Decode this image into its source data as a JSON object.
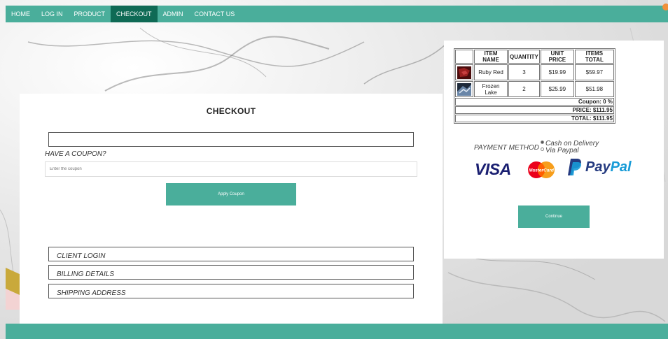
{
  "nav": {
    "items": [
      {
        "label": "HOME"
      },
      {
        "label": "LOG IN"
      },
      {
        "label": "PRODUCT"
      },
      {
        "label": "CHECKOUT",
        "active": true
      },
      {
        "label": "ADMIN"
      },
      {
        "label": "CONTACT US"
      }
    ],
    "color": "#4aae9b",
    "active_color": "#0f6a55"
  },
  "checkout": {
    "title": "CHECKOUT",
    "coupon_label": "HAVE A COUPON?",
    "coupon_placeholder": "Enter the coupon",
    "apply_label": "Apply Coupon",
    "sections": [
      {
        "label": "CLIENT LOGIN"
      },
      {
        "label": "BILLING DETAILS"
      },
      {
        "label": "SHIPPING ADDRESS"
      }
    ]
  },
  "cart": {
    "headers": [
      "",
      "ITEM NAME",
      "QUANTITY",
      "UNIT PRICE",
      "ITEMS TOTAL"
    ],
    "items": [
      {
        "name": "Ruby Red",
        "quantity": "3",
        "unit_price": "$19.99",
        "total": "$59.97",
        "thumb_color": "#7a1414"
      },
      {
        "name": "Frozen Lake",
        "quantity": "2",
        "unit_price": "$25.99",
        "total": "$51.98",
        "thumb_color": "#2a3d5a"
      }
    ],
    "coupon": "Coupon: 0 %",
    "price": "PRICE: $111.95",
    "total": "TOTAL: $111.95"
  },
  "payment": {
    "label": "PAYMENT METHOD",
    "options": [
      {
        "label": "Cash on Delivery",
        "checked": true
      },
      {
        "label": "Via Paypal",
        "checked": false
      }
    ],
    "logos": {
      "visa": "VISA",
      "mastercard": "MasterCard",
      "paypal_1": "Pay",
      "paypal_2": "Pal"
    }
  },
  "continue_label": "Continue",
  "accent": "#4aae9b"
}
